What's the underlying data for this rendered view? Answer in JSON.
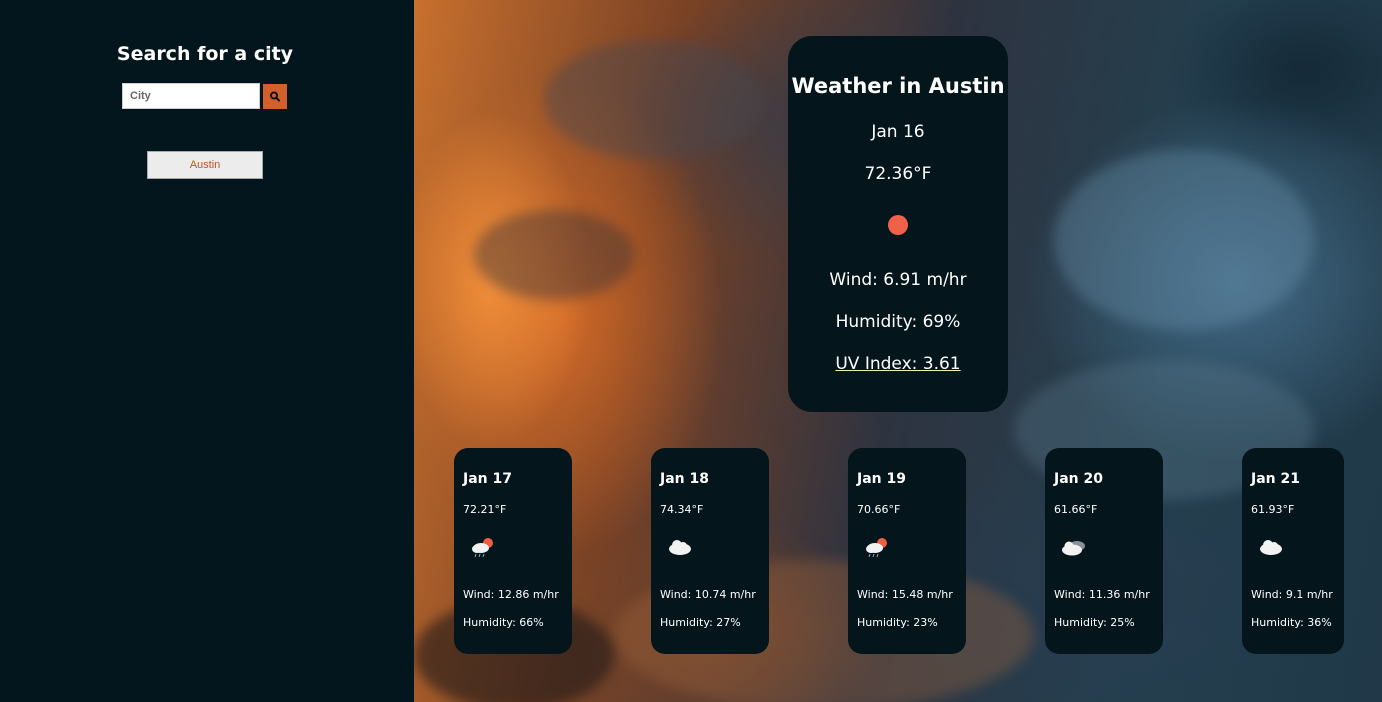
{
  "sidebar": {
    "title": "Search for a city",
    "search_placeholder": "City",
    "search_button_icon": "search-icon",
    "history": [
      "Austin"
    ]
  },
  "colors": {
    "accent": "#d2602b",
    "sidebar_bg": "#04161d",
    "card_bg": "#04151c",
    "sun": "#f0614a"
  },
  "current": {
    "title": "Weather in Austin",
    "date": "Jan 16",
    "temp": "72.36°F",
    "icon": "sun-icon",
    "wind": "Wind: 6.91 m/hr",
    "humidity": "Humidity: 69%",
    "uv": "UV Index: 3.61"
  },
  "forecast": [
    {
      "date": "Jan 17",
      "temp": "72.21°F",
      "icon": "partly-cloudy-rain-icon",
      "wind": "Wind: 12.86 m/hr",
      "humidity": "Humidity: 66%"
    },
    {
      "date": "Jan 18",
      "temp": "74.34°F",
      "icon": "cloud-icon",
      "wind": "Wind: 10.74 m/hr",
      "humidity": "Humidity: 27%"
    },
    {
      "date": "Jan 19",
      "temp": "70.66°F",
      "icon": "partly-cloudy-rain-icon",
      "wind": "Wind: 15.48 m/hr",
      "humidity": "Humidity: 23%"
    },
    {
      "date": "Jan 20",
      "temp": "61.66°F",
      "icon": "cloudy-icon",
      "wind": "Wind: 11.36 m/hr",
      "humidity": "Humidity: 25%"
    },
    {
      "date": "Jan 21",
      "temp": "61.93°F",
      "icon": "cloud-icon",
      "wind": "Wind: 9.1 m/hr",
      "humidity": "Humidity: 36%"
    }
  ]
}
